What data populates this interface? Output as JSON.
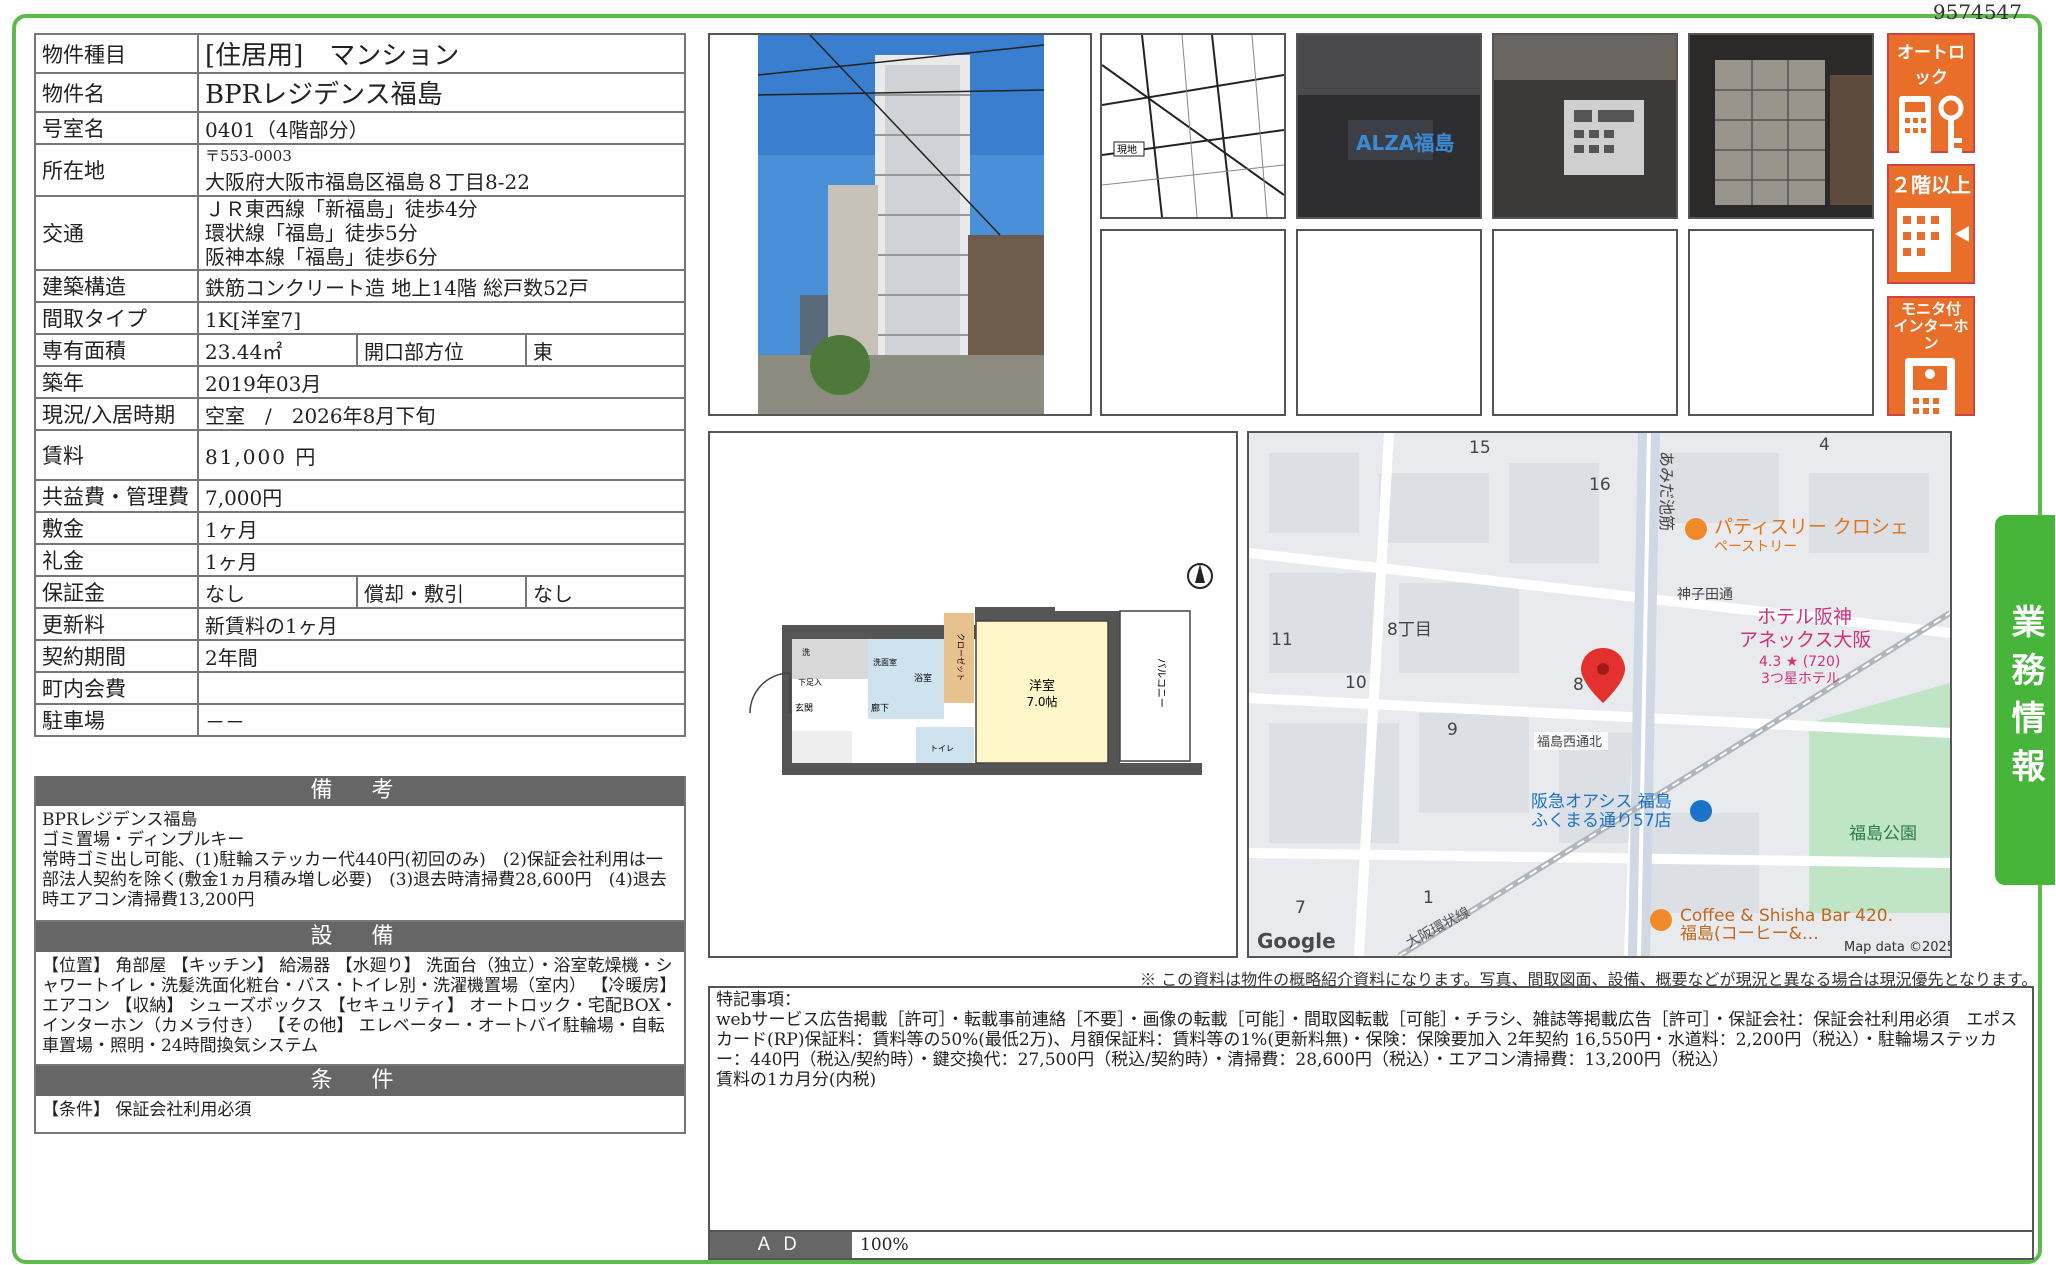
{
  "doc_id": "9574547",
  "spec": {
    "type_label": "物件種目",
    "type_value": "[住居用]　マンション",
    "name_label": "物件名",
    "name_value": "BPRレジデンス福島",
    "room_label": "号室名",
    "room_value": "0401（4階部分）",
    "addr_label": "所在地",
    "postal": "〒553-0003",
    "addr_value": "大阪府大阪市福島区福島８丁目8-22",
    "access_label": "交通",
    "access_1": "ＪＲ東西線「新福島」徒歩4分",
    "access_2": "環状線「福島」徒歩5分",
    "access_3": "阪神本線「福島」徒歩6分",
    "structure_label": "建築構造",
    "structure_value": "鉄筋コンクリート造 地上14階 総戸数52戸",
    "layout_label": "間取タイプ",
    "layout_value": "1K[洋室7]",
    "area_label": "専有面積",
    "area_value": "23.44㎡",
    "facing_label": "開口部方位",
    "facing_value": "東",
    "built_label": "築年",
    "built_value": "2019年03月",
    "status_label": "現況/入居時期",
    "status_value": "空室　/　2026年8月下旬",
    "rent_label": "賃料",
    "rent_value": "81,000 円",
    "fee_label": "共益費・管理費",
    "fee_value": "7,000円",
    "deposit_label": "敷金",
    "deposit_value": "1ヶ月",
    "keymoney_label": "礼金",
    "keymoney_value": "1ヶ月",
    "guarantee_label": "保証金",
    "guarantee_value": "なし",
    "amort_label": "償却・敷引",
    "amort_value": "なし",
    "renewal_label": "更新料",
    "renewal_value": "新賃料の1ヶ月",
    "contract_label": "契約期間",
    "contract_value": "2年間",
    "town_label": "町内会費",
    "town_value": "",
    "parking_label": "駐車場",
    "parking_value": "－－"
  },
  "remarks": {
    "title": "備 考",
    "text": "BPRレジデンス福島\nゴミ置場・ディンプルキー\n常時ゴミ出し可能、(1)駐輪ステッカー代440円(初回のみ)　(2)保証会社利用は一部法人契約を除く(敷金1ヵ月積み増し必要)　(3)退去時清掃費28,600円　(4)退去時エアコン清掃費13,200円"
  },
  "facilities": {
    "title": "設 備",
    "text": "【位置】 角部屋 【キッチン】 給湯器 【水廻り】 洗面台（独立）・浴室乾燥機・シャワートイレ・洗髪洗面化粧台・バス・トイレ別・洗濯機置場（室内） 【冷暖房】 エアコン 【収納】 シューズボックス 【セキュリティ】 オートロック・宅配BOX・インターホン（カメラ付き） 【その他】 エレベーター・オートバイ駐輪場・自転車置場・照明・24時間換気システム"
  },
  "conditions": {
    "title": "条 件",
    "text": "【条件】 保証会社利用必須"
  },
  "badges": {
    "b1": "オートロック",
    "b2": "２階以上",
    "b3a": "モニタ付",
    "b3b": "インターホン"
  },
  "side_tab": "業務情報",
  "photos": {
    "entrance_sign": "ALZA福島",
    "map_label": "現地"
  },
  "floorplan": {
    "room": "洋室",
    "size": "7.0帖",
    "balcony": "バルコニー",
    "closet": "クローゼット",
    "bath": "浴室",
    "washroom": "洗面室",
    "entrance": "玄関",
    "hall": "廊下",
    "toilet": "トイレ",
    "shoes": "下足入",
    "wm": "洗"
  },
  "map": {
    "n15": "15",
    "n16": "16",
    "n4": "4",
    "n11": "11",
    "n10": "10",
    "n9": "9",
    "n8": "8",
    "n7": "7",
    "n1": "1",
    "chome": "8丁目",
    "road": "あみだ池筋",
    "pastry": "パティスリー クロシェ",
    "pastry_sub": "ペーストリー",
    "kamiko": "神子田通",
    "hotel1": "ホテル阪神",
    "hotel2": "アネックス大阪",
    "hotel_rating": "4.3 ★ (720)",
    "hotel_type": "3つ星ホテル",
    "nishi": "福島西通北",
    "oasis1": "阪急オアシス 福島",
    "oasis2": "ふくまる通り57店",
    "park": "福島公園",
    "coffee1": "Coffee & Shisha Bar 420.",
    "coffee2": "福島(コーヒー&…",
    "kanjo": "大阪環状線",
    "google": "Google",
    "mapdata": "Map data ©2025"
  },
  "note": "※ この資料は物件の概略紹介資料になります。写真、間取図面、設備、概要などが現況と異なる場合は現況優先となります。",
  "tokki": "特記事項：\nwebサービス広告掲載［許可］・転載事前連絡［不要］・画像の転載［可能］・間取図転載［可能］・チラシ、雑誌等掲載広告［許可］・保証会社：保証会社利用必須　エポスカード(RP)保証料：賃料等の50%(最低2万)、月額保証料：賃料等の1%(更新料無)・保険：保険要加入 2年契約 16,550円・水道料：2,200円（税込）・駐輪場ステッカー：440円（税込/契約時）・鍵交換代：27,500円（税込/契約時）・清掃費：28,600円（税込）・エアコン清掃費：13,200円（税込）\n賃料の1カ月分(内税)",
  "ad": {
    "label": "ＡＤ",
    "value": "100%"
  }
}
